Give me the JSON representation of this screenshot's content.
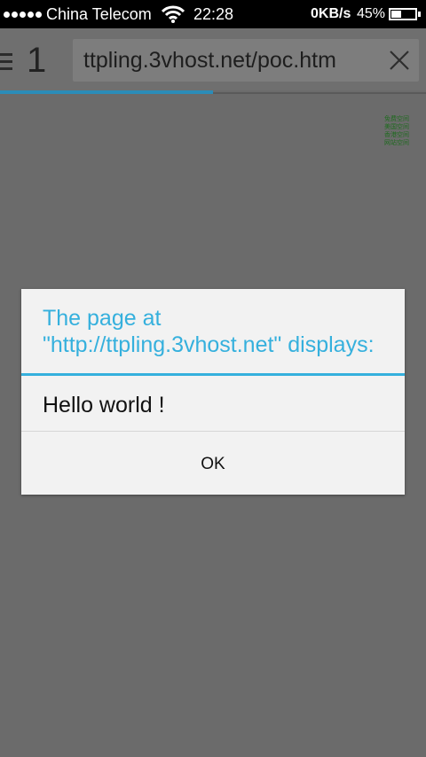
{
  "status_bar": {
    "carrier": "China Telecom",
    "time": "22:28",
    "net_speed": "0KB/s",
    "battery_percent": "45%",
    "battery_level": 0.45,
    "signal_dots": 5,
    "icons": [
      "signal-dots-icon",
      "wifi-icon",
      "battery-icon"
    ]
  },
  "browser": {
    "menu_icon": "menu-icon",
    "tab_count": "1",
    "url": "ttpling.3vhost.net/poc.htm",
    "clear_icon": "close-icon",
    "load_progress": 0.5
  },
  "page": {
    "ad_lines": [
      "免费空间",
      "美国空间",
      "香港空间",
      "网站空间"
    ]
  },
  "dialog": {
    "title": "The page at \"http://ttpling.3vhost.net\" displays:",
    "message": "Hello world !",
    "ok_label": "OK"
  },
  "colors": {
    "accent": "#35b0dd",
    "status_bar_bg": "#000000",
    "overlay_bg": "#6b6b6b",
    "dialog_bg": "#f2f2f2",
    "progress": "#2b8cb8",
    "ad_text": "#1f6b1f"
  }
}
